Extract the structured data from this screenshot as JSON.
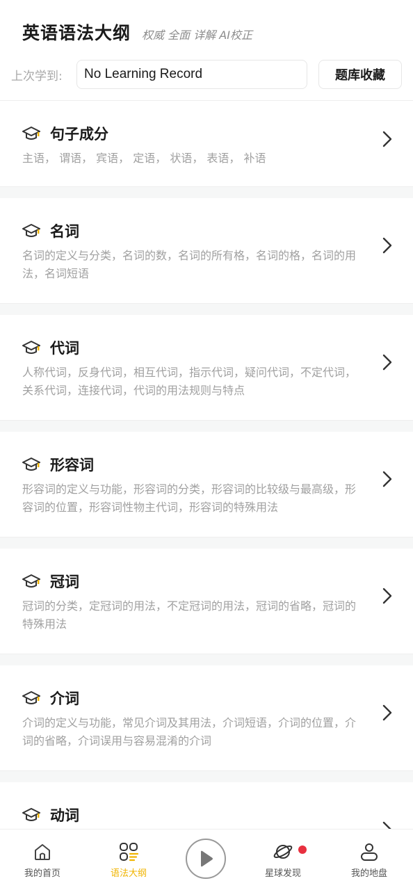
{
  "header": {
    "title": "英语语法大纲",
    "subtitle": "权威 全面 详解 AI校正"
  },
  "last_study": {
    "label": "上次学到:",
    "value": "No Learning Record",
    "bank_button": "题库收藏"
  },
  "topics": [
    {
      "title": "句子成分",
      "desc": "主语， 谓语， 宾语， 定语， 状语， 表语， 补语"
    },
    {
      "title": "名词",
      "desc": "名词的定义与分类，名词的数，名词的所有格，名词的格，名词的用法，名词短语"
    },
    {
      "title": "代词",
      "desc": "人称代词，反身代词，相互代词，指示代词，疑问代词，不定代词，关系代词，连接代词，代词的用法规则与特点"
    },
    {
      "title": "形容词",
      "desc": "形容词的定义与功能，形容词的分类，形容词的比较级与最高级，形容词的位置，形容词性物主代词，形容词的特殊用法"
    },
    {
      "title": "冠词",
      "desc": "冠词的分类，定冠词的用法，不定冠词的用法，冠词的省略，冠词的特殊用法"
    },
    {
      "title": "介词",
      "desc": "介词的定义与功能，常见介词及其用法，介词短语，介词的位置，介词的省略，介词误用与容易混淆的介词"
    },
    {
      "title": "动词",
      "desc": ""
    }
  ],
  "tabbar": {
    "home": "我的首页",
    "grammar": "语法大纲",
    "discover": "星球发现",
    "profile": "我的地盘"
  },
  "colors": {
    "accent": "#f0b400",
    "badge": "#e8303f",
    "muted_text": "#a0a0a0"
  },
  "icons": {
    "topic": "graduation-cap-icon",
    "chevron": "chevron-right-icon",
    "home": "home-icon",
    "grammar": "grid-list-icon",
    "play": "play-icon",
    "discover": "planet-icon",
    "profile": "user-icon"
  }
}
